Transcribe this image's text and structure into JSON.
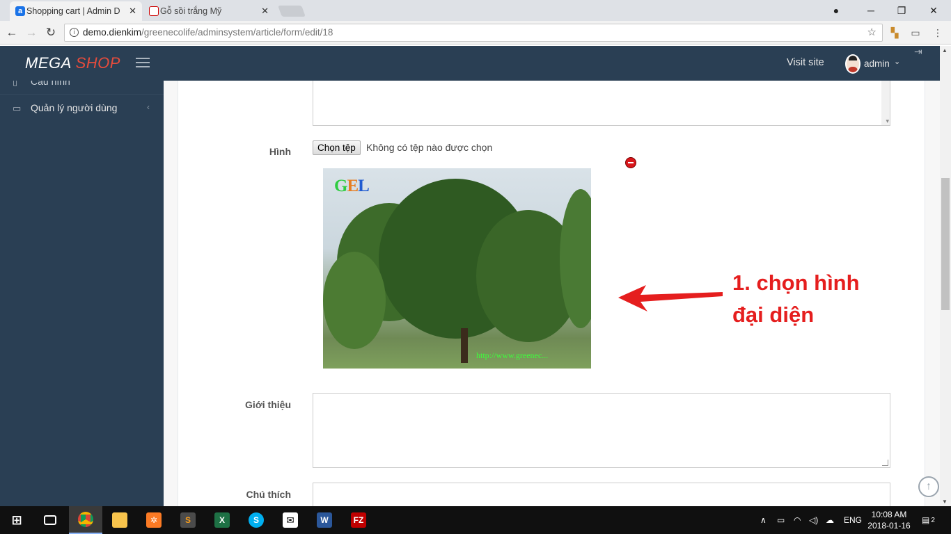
{
  "browser": {
    "tabs": [
      {
        "title": "Shopping cart | Admin D",
        "active": true,
        "favicon": "a"
      },
      {
        "title": "Gỗ sồi trắng Mỹ",
        "active": false
      }
    ],
    "url_host": "demo.dienkim",
    "url_path": "/greenecolife/adminsystem/article/form/edit/18"
  },
  "header": {
    "brand_main": "MEGA",
    "brand_accent": "SHOP",
    "visit_site": "Visit site",
    "user": "admin"
  },
  "sidebar": {
    "items": [
      {
        "label": "Cấu hình",
        "icon": "file-icon"
      },
      {
        "label": "Quản lý người dùng",
        "icon": "folder-icon"
      }
    ]
  },
  "form": {
    "image_label": "Hình",
    "file_button": "Chọn tệp",
    "file_status": "Không có tệp nào được chọn",
    "image_watermark_logo": [
      "G",
      "E",
      "L"
    ],
    "image_watermark_url": "http://www.greenec... ",
    "intro_label": "Giới thiệu",
    "note_label": "Chú thích"
  },
  "annotation": {
    "line1": "1. chọn hình",
    "line2": "đại diện"
  },
  "taskbar": {
    "lang": "ENG",
    "time": "10:08 AM",
    "date": "2018-01-16",
    "notifications": "2"
  },
  "colors": {
    "header_bg": "#2a3f54",
    "brand_accent": "#e74c3c",
    "annotation": "#e51e1e"
  }
}
